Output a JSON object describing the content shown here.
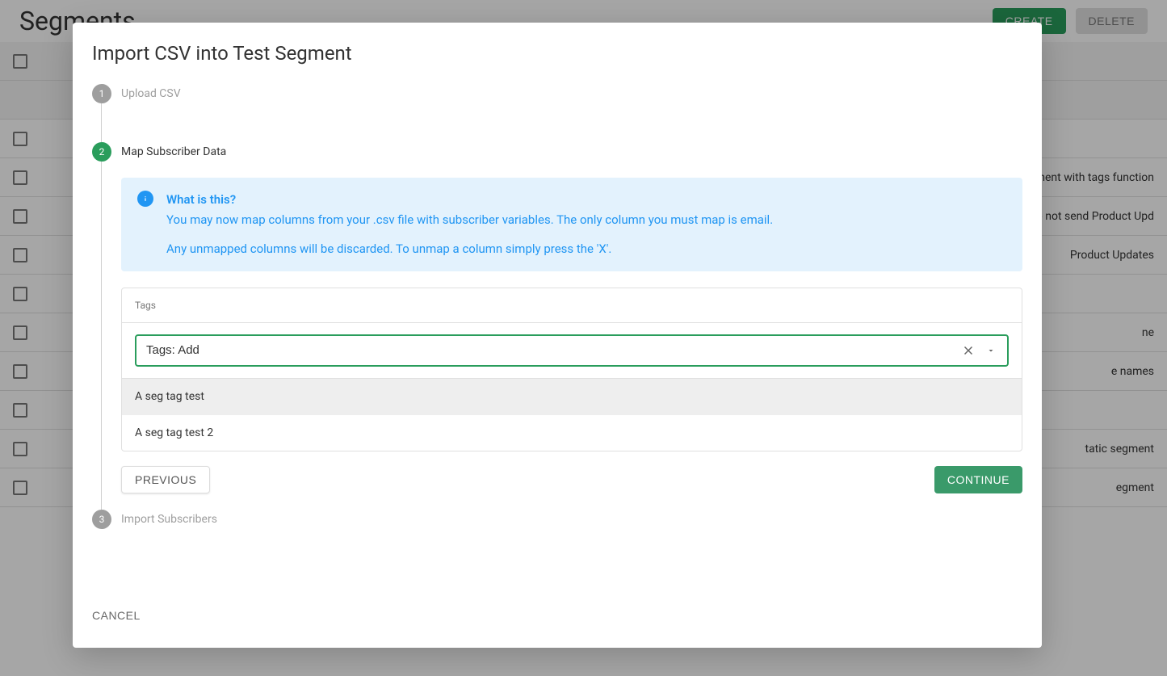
{
  "page": {
    "title": "Segments",
    "create_label": "CREATE",
    "delete_label": "DELETE"
  },
  "rows": [
    {
      "text": ""
    },
    {
      "text": ""
    },
    {
      "text": "gment with tags function"
    },
    {
      "text": "Do not send Product Upd"
    },
    {
      "text": "Product Updates"
    },
    {
      "text": ""
    },
    {
      "text": "ne"
    },
    {
      "text": "e names"
    },
    {
      "text": ""
    },
    {
      "text": "tatic segment"
    },
    {
      "text": "egment"
    }
  ],
  "modal": {
    "title": "Import CSV into Test Segment",
    "steps": {
      "s1": {
        "num": "1",
        "label": "Upload CSV"
      },
      "s2": {
        "num": "2",
        "label": "Map Subscriber Data"
      },
      "s3": {
        "num": "3",
        "label": "Import Subscribers"
      }
    },
    "info": {
      "title": "What is this?",
      "line1": "You may now map columns from your .csv file with subscriber variables. The only column you must map is email.",
      "line2": "Any unmapped columns will be discarded. To unmap a column simply press the 'X'."
    },
    "mapping": {
      "header": "Tags",
      "value": "Tags: Add",
      "options": {
        "o0": "A seg tag test",
        "o1": "A seg tag test 2"
      }
    },
    "buttons": {
      "previous": "PREVIOUS",
      "continue": "CONTINUE",
      "cancel": "CANCEL"
    }
  }
}
